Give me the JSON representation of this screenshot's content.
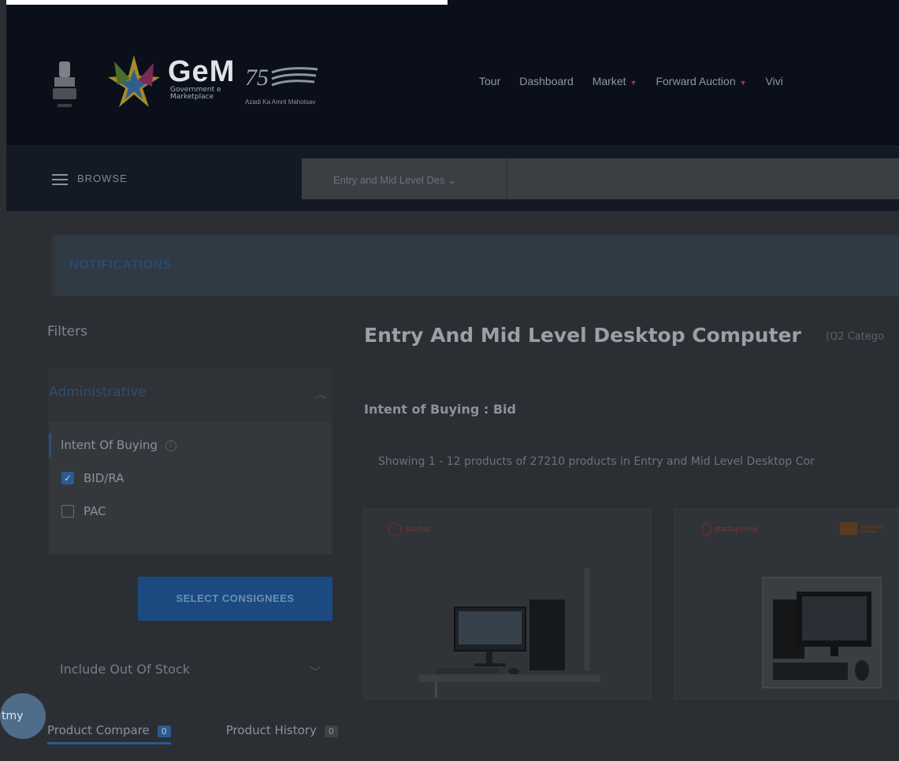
{
  "header": {
    "logo_text": "GeM",
    "logo_sub": "Government e Marketplace",
    "azadi_text": "Azadi Ka Amrit Mahotsav",
    "nav": [
      {
        "label": "Tour",
        "dropdown": false
      },
      {
        "label": "Dashboard",
        "dropdown": false
      },
      {
        "label": "Market",
        "dropdown": true
      },
      {
        "label": "Forward Auction",
        "dropdown": true
      },
      {
        "label": "Vivi",
        "dropdown": false
      }
    ]
  },
  "browse": {
    "label": "BROWSE",
    "category_selected": "Entry and Mid Level Des ⌄",
    "search_placeholder": ""
  },
  "notifications": {
    "label": "NOTIFICATIONS"
  },
  "filters": {
    "title": "Filters",
    "section": "Administrative",
    "group_label": "Intent Of Buying",
    "options": [
      {
        "label": "BID/RA",
        "checked": true
      },
      {
        "label": "PAC",
        "checked": false
      }
    ],
    "select_button": "SELECT CONSIGNEES",
    "out_of_stock": "Include Out Of Stock"
  },
  "main": {
    "title": "Entry And Mid Level Desktop Computer",
    "title_sub": "(Q2 Catego",
    "intent": "Intent of Buying : Bid",
    "showing": "Showing 1 - 12 products of 27210 products in Entry and Mid Level Desktop Cor",
    "cards": [
      {
        "badge": "startup"
      },
      {
        "badge": "startupindia"
      }
    ]
  },
  "bottom": {
    "compare_label": "Product Compare",
    "compare_count": "0",
    "history_label": "Product History",
    "history_count": "0"
  },
  "chat": {
    "label": "tmy"
  },
  "colors": {
    "nav_bg": "#0a0f1a",
    "accent": "#2b5a8f",
    "overlay": "#2b2e33"
  }
}
